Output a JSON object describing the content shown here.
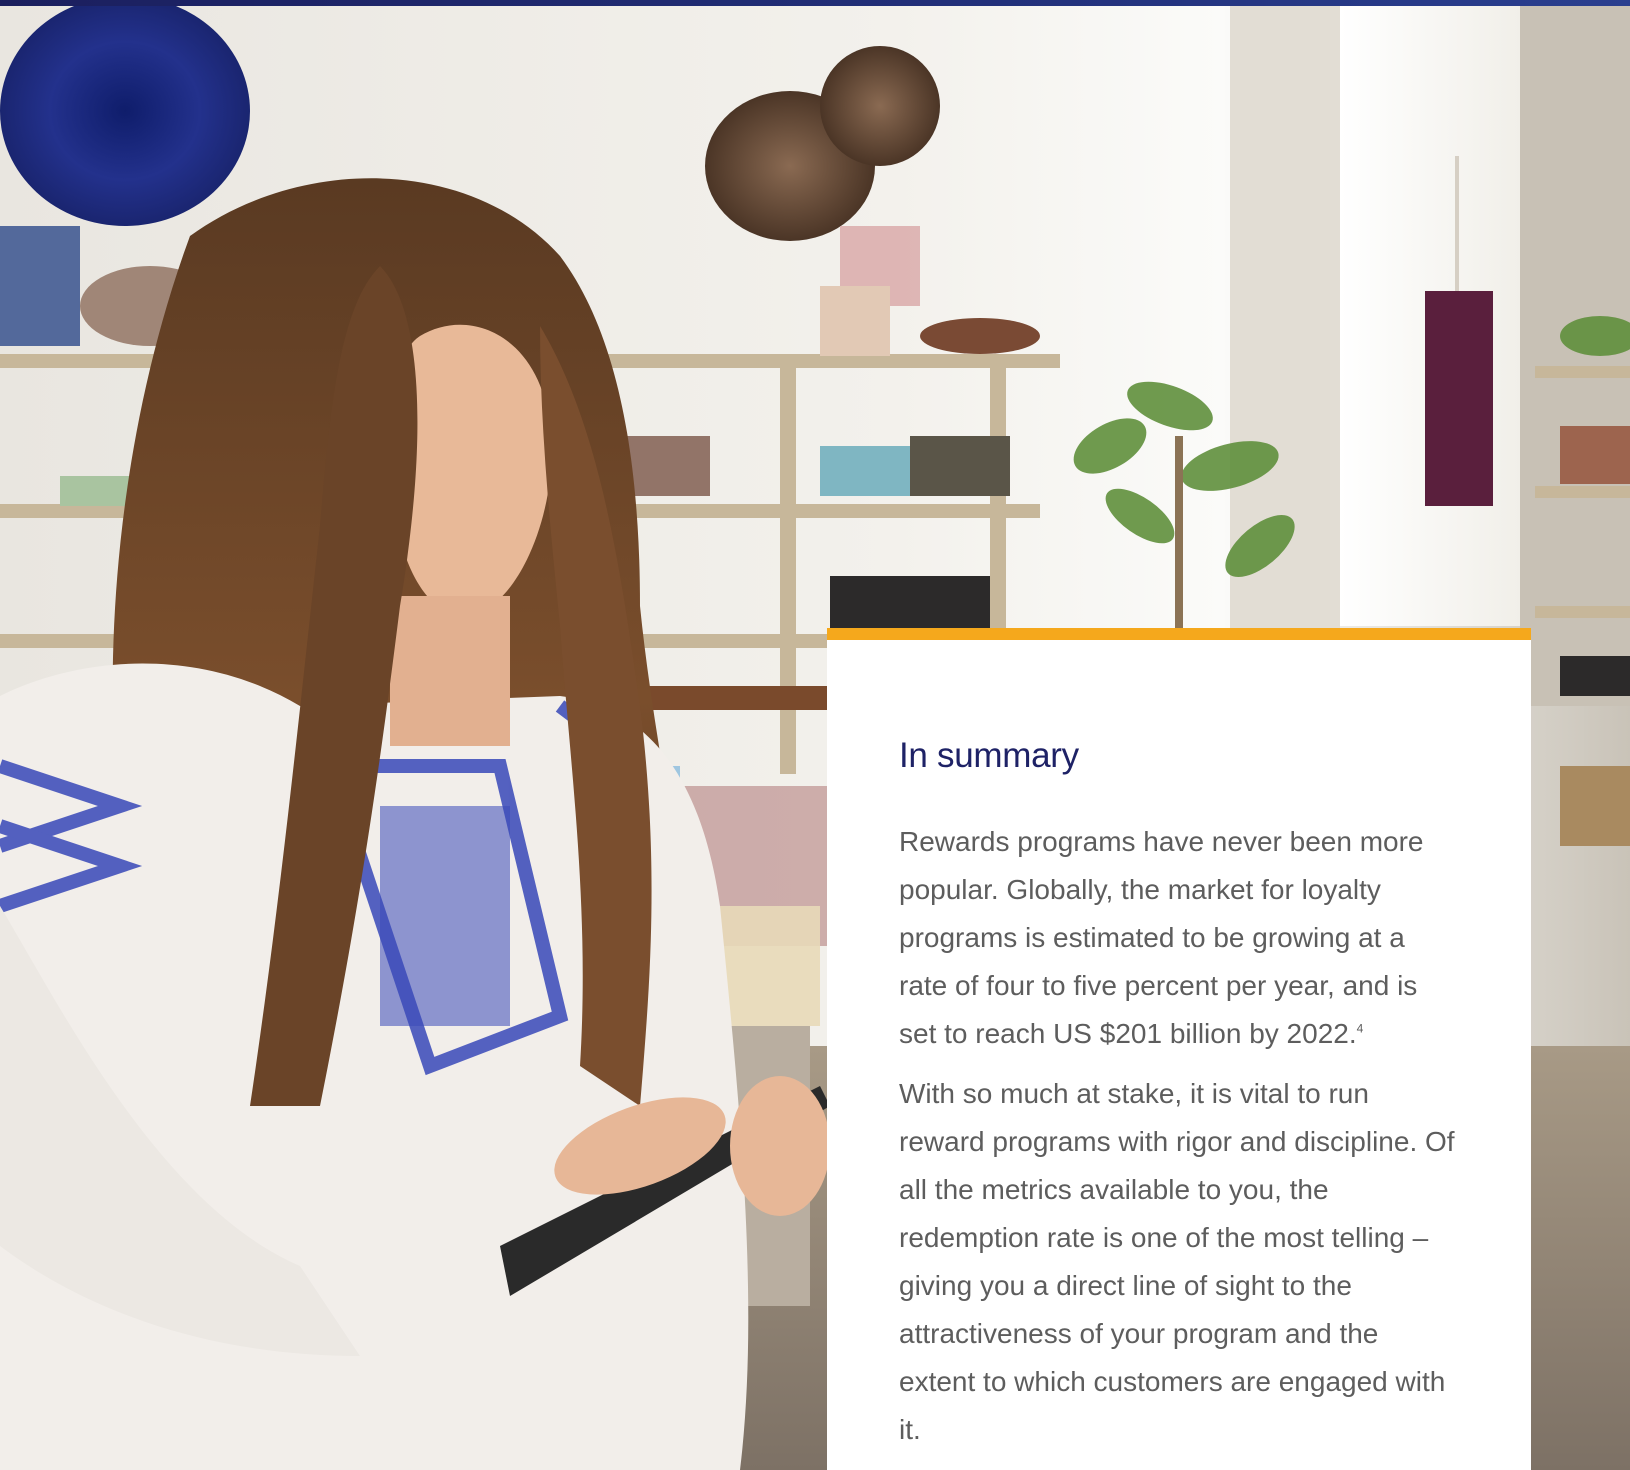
{
  "summary": {
    "title": "In summary",
    "paragraph_1": "Rewards programs have never been more popular. Globally, the market for loyalty programs is estimated to be growing at a rate of four to five percent per year, and is set to reach US $201 billion by 2022.",
    "footnote_ref": "4",
    "paragraph_2": "With so much at stake, it is vital to run reward programs with rigor and discipline. Of all the metrics available to you, the redemption rate is one of the most telling – giving you a direct line of sight to the attractiveness of your program and the extent to which customers are engaged with it."
  },
  "colors": {
    "top_bar": "#1b1f5e",
    "accent": "#f5a81c",
    "title": "#1e2266",
    "body_text": "#5d5d5d"
  }
}
